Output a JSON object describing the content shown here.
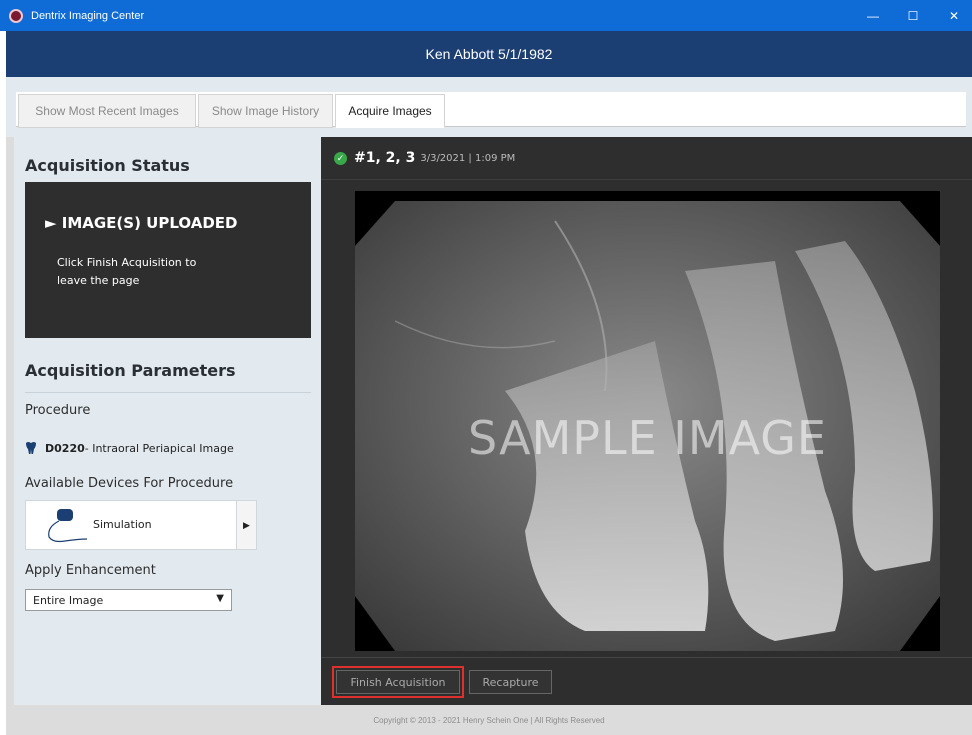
{
  "window": {
    "title": "Dentrix Imaging Center",
    "controls": {
      "minimize": "—",
      "maximize": "☐",
      "close": "✕"
    }
  },
  "patient": {
    "name_dob": "Ken Abbott 5/1/1982"
  },
  "tabs": [
    {
      "label": "Show Most Recent Images",
      "active": false
    },
    {
      "label": "Show Image History",
      "active": false
    },
    {
      "label": "Acquire Images",
      "active": true
    }
  ],
  "acquisition_status": {
    "title": "Acquisition Status",
    "state": "► IMAGE(S) UPLOADED",
    "message": "Click Finish Acquisition to leave the page"
  },
  "acquisition_parameters": {
    "title": "Acquisition Parameters",
    "procedure_label": "Procedure",
    "procedure_code": "D0220",
    "procedure_desc": " - Intraoral Periapical Image",
    "devices_label": "Available Devices For Procedure",
    "device_name": "Simulation",
    "enhancement_label": "Apply Enhancement",
    "enhancement_value": "Entire Image"
  },
  "viewer": {
    "teeth": "#1, 2, 3",
    "datetime": "3/3/2021 | 1:09 PM",
    "watermark": "SAMPLE IMAGE",
    "finish_button": "Finish Acquisition",
    "recapture_button": "Recapture"
  },
  "footer": {
    "copyright": "Copyright © 2013 - 2021 Henry Schein One | All Rights Reserved"
  },
  "colors": {
    "titlebar": "#0f6cd6",
    "patient_bar": "#1c3f73",
    "panel_bg": "#e2eaf0",
    "viewer_bg": "#2e2e2e",
    "success": "#39a84a",
    "highlight": "#e0302d"
  }
}
